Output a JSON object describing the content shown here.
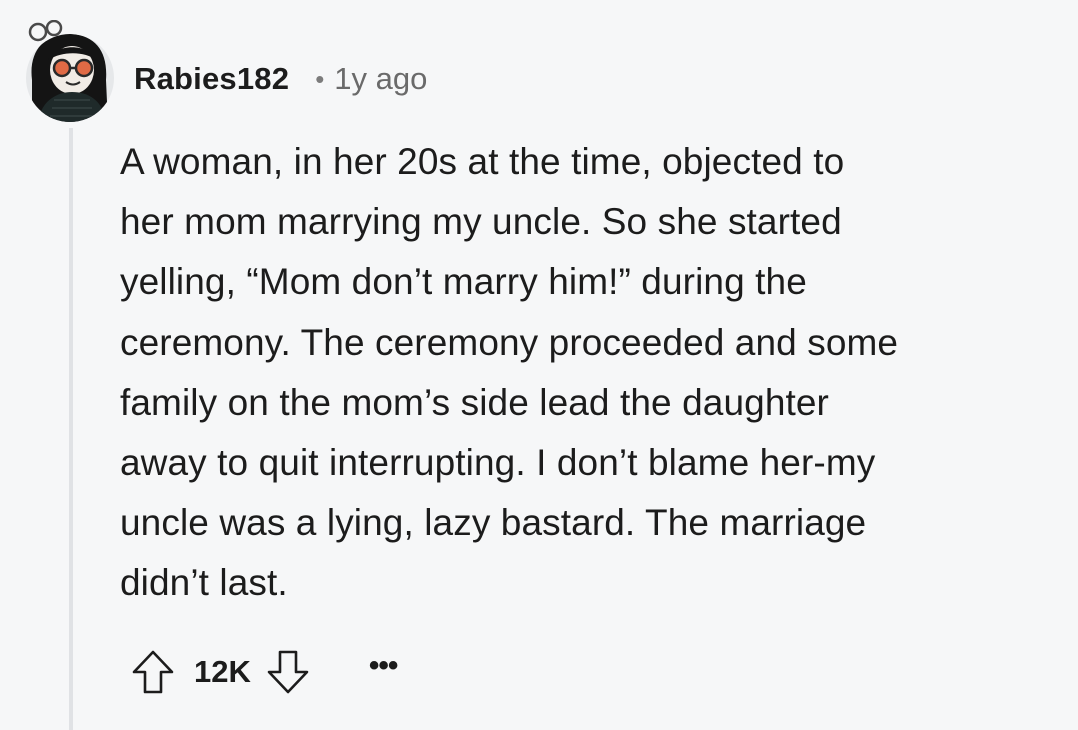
{
  "comment": {
    "author": "Rabies182",
    "separator": "•",
    "age": "1y ago",
    "body_lines": [
      "A woman, in her 20s at the time, objected to",
      "her mom marrying my uncle. So she started",
      "yelling, “Mom don’t marry him!” during the",
      "ceremony. The ceremony proceeded and some",
      "family on the mom’s side lead the daughter",
      "away to quit interrupting. I don’t blame her-my",
      "uncle was a lying, lazy bastard. The marriage",
      "didn’t last."
    ],
    "score": "12K",
    "more_label": "•••"
  },
  "icons": {
    "upvote": "arrow-up-icon",
    "downvote": "arrow-down-icon",
    "avatar": "user-avatar-icon"
  },
  "colors": {
    "background": "#f6f7f8",
    "text": "#1c1c1c",
    "meta": "#6a6a6a",
    "thread_line": "#e0e2e5"
  }
}
